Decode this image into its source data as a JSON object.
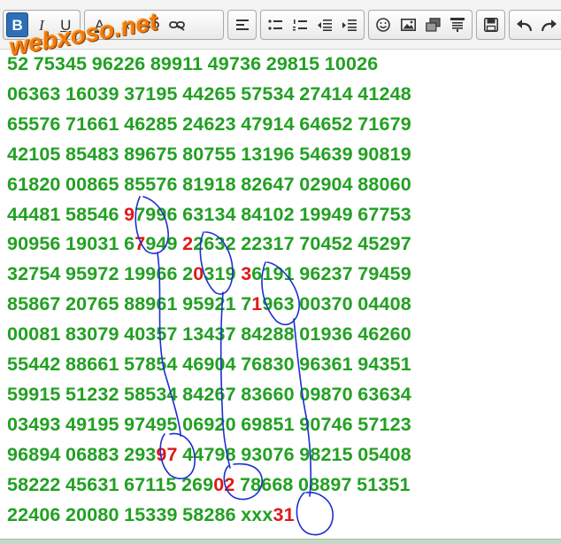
{
  "toolbar": {
    "groups": [
      [
        "bold-icon",
        "italic-icon",
        "underline-icon"
      ],
      [
        "text-color-icon",
        "text-size-icon",
        "link-icon",
        "unlink-icon"
      ],
      [
        "align-left-icon"
      ],
      [
        "bullet-list-icon",
        "numbered-list-icon",
        "outdent-icon",
        "indent-icon"
      ],
      [
        "emoticon-icon",
        "image-icon",
        "media-icon",
        "quote-icon"
      ],
      [
        "save-icon"
      ],
      [
        "undo-icon",
        "redo-icon"
      ]
    ],
    "bold_label": "B",
    "italic_label": "I",
    "underline_label": "U",
    "text_color_label": "A",
    "text_size_label": "A"
  },
  "watermark": "webxoso.net",
  "rows": [
    [
      "52",
      "75345",
      "96226",
      "89911",
      "49736",
      "29815",
      "10026"
    ],
    [
      "06363",
      "16039",
      "37195",
      "44265",
      "57534",
      "27414",
      "41248"
    ],
    [
      "65576",
      "71661",
      "46285",
      "24623",
      "47914",
      "64652",
      "71679"
    ],
    [
      "42105",
      "85483",
      "89675",
      "80755",
      "13196",
      "54639",
      "90819"
    ],
    [
      "61820",
      "00865",
      "85576",
      "81918",
      "82647",
      "02904",
      "88060"
    ],
    [
      "44481",
      "58546",
      "97996",
      "63134",
      "84102",
      "19949",
      "67753"
    ],
    [
      "90956",
      "19031",
      "67949",
      "22632",
      "22317",
      "70452",
      "45297"
    ],
    [
      "32754",
      "95972",
      "19966",
      "20319",
      "36191",
      "96237",
      "79459"
    ],
    [
      "85867",
      "20765",
      "88961",
      "95921",
      "71963",
      "00370",
      "04408"
    ],
    [
      "00081",
      "83079",
      "40357",
      "13437",
      "84288",
      "01936",
      "46260"
    ],
    [
      "55442",
      "88661",
      "57854",
      "46904",
      "76830",
      "96361",
      "94351"
    ],
    [
      "59915",
      "51232",
      "58534",
      "84267",
      "83660",
      "09870",
      "63634"
    ],
    [
      "03493",
      "49195",
      "97495",
      "06920",
      "69851",
      "90746",
      "57123"
    ],
    [
      "96894",
      "06883",
      "29397",
      "44798",
      "93076",
      "98215",
      "05408"
    ],
    [
      "58222",
      "45631",
      "67115",
      "26902",
      "78668",
      "08897",
      "51351"
    ],
    [
      "22406",
      "20080",
      "15339",
      "58286",
      "xxx31"
    ]
  ],
  "highlights": {
    "row5_col2": {
      "pre": "",
      "hl": "9",
      "post": "7996"
    },
    "row6_col2": {
      "pre": "6",
      "hl": "7",
      "post": "949"
    },
    "row6_col3": {
      "pre": "",
      "hl": "2",
      "post": "2632"
    },
    "row7_col3": {
      "pre": "2",
      "hl": "0",
      "post": "319"
    },
    "row7_col4": {
      "pre": "",
      "hl": "3",
      "post": "6191"
    },
    "row8_col4": {
      "pre": "7",
      "hl": "1",
      "post": "963"
    },
    "row13_col2": {
      "pre": "293",
      "hl": "97",
      "post": ""
    },
    "row14_col3": {
      "pre": "269",
      "hl": "02",
      "post": ""
    },
    "row15_col4": {
      "pre": "xxx",
      "hl": "31",
      "post": ""
    }
  },
  "colors": {
    "number_green": "#22a022",
    "highlight_red": "#e01818",
    "scribble_blue": "#1a2fd0",
    "watermark_orange": "#f07d10",
    "active_button": "#2d6fb7"
  }
}
